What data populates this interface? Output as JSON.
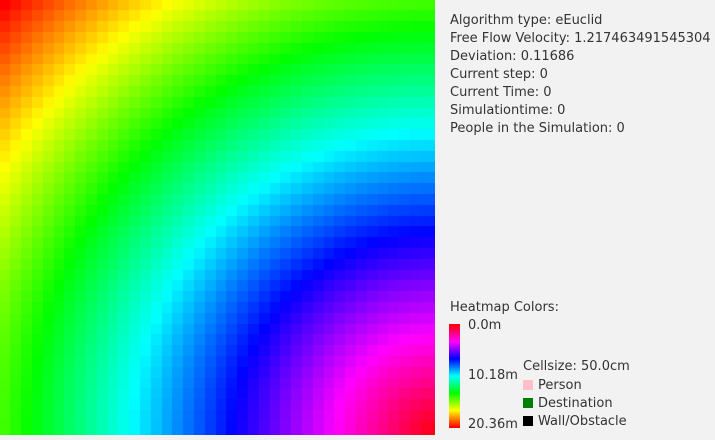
{
  "info": {
    "algorithm": "Algorithm type: eEuclid",
    "free_flow_velocity": "Free Flow Velocity: 1.217463491545304",
    "deviation": "Deviation: 0.11686",
    "current_step": "Current step: 0",
    "current_time": "Current Time: 0",
    "simulation_time": "Simulationtime: 0",
    "people": "People in the Simulation: 0"
  },
  "legend": {
    "title": "Heatmap Colors:",
    "min_label": "0.0m",
    "mid_label": "10.18m",
    "max_label": "20.36m",
    "cellsize": "Cellsize: 50.0cm",
    "items": [
      {
        "label": "Person",
        "color": "#ffc0cb"
      },
      {
        "label": "Destination",
        "color": "#008000"
      },
      {
        "label": "Wall/Obstacle",
        "color": "#000000"
      }
    ]
  },
  "grid": {
    "max_distance_m": 20.36,
    "cellsize_m": 0.5,
    "destination_color": "#008000",
    "destination_border": "#004d00"
  }
}
